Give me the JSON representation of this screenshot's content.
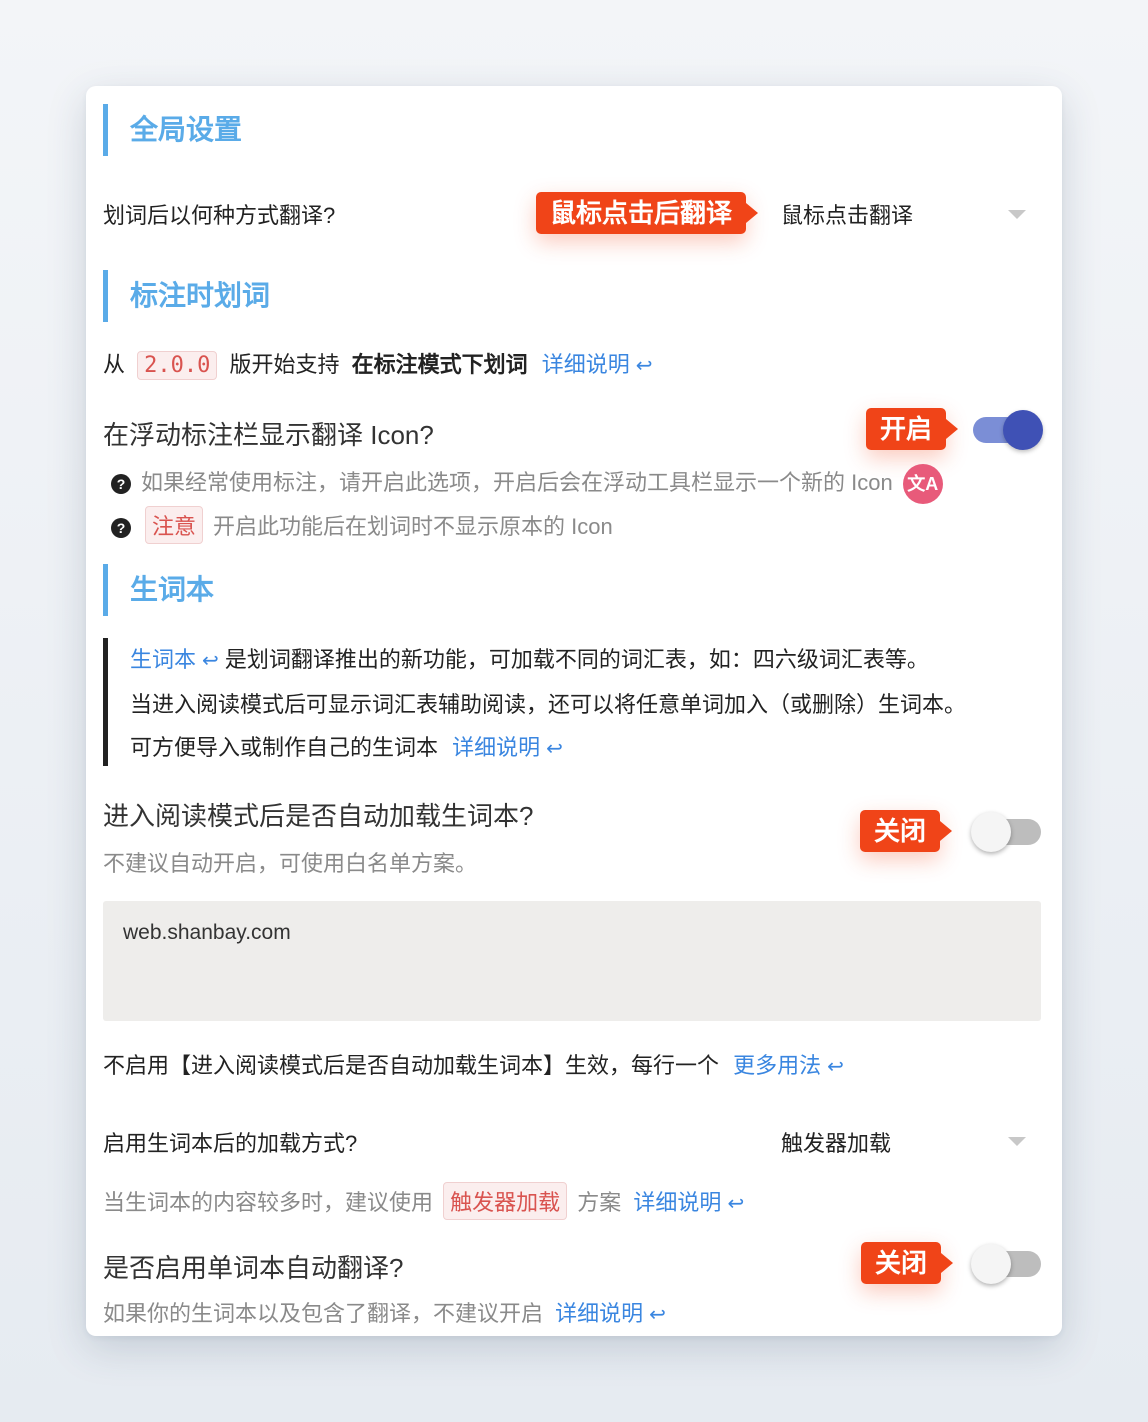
{
  "global": {
    "title": "全局设置",
    "translate_mode_label": "划词后以何种方式翻译?",
    "translate_mode_callout": "鼠标点击后翻译",
    "translate_mode_value": "鼠标点击翻译"
  },
  "annotate": {
    "title": "标注时划词",
    "intro_prefix": "从",
    "intro_version": "2.0.0",
    "intro_mid": "版开始支持",
    "intro_bold": "在标注模式下划词",
    "intro_link": "详细说明",
    "icon_question": "在浮动标注栏显示翻译 Icon?",
    "icon_callout": "开启",
    "icon_switch_state": "on",
    "hint1": "如果经常使用标注，请开启此选项，开启后会在浮动工具栏显示一个新的 Icon",
    "translate_icon_glyph": "文A",
    "hint2_tag": "注意",
    "hint2_text": "开启此功能后在划词时不显示原本的 Icon",
    "question_glyph": "?"
  },
  "vocab": {
    "title": "生词本",
    "quote_link": "生词本",
    "quote_line1": "是划词翻译推出的新功能，可加载不同的词汇表，如：四六级词汇表等。",
    "quote_line2": "当进入阅读模式后可显示词汇表辅助阅读，还可以将任意单词加入（或删除）生词本。",
    "quote_line3": "可方便导入或制作自己的生词本",
    "quote_line3_link": "详细说明",
    "autoload_question": "进入阅读模式后是否自动加载生词本?",
    "autoload_hint": "不建议自动开启，可使用白名单方案。",
    "autoload_callout": "关闭",
    "autoload_switch_state": "off",
    "whitelist_value": "web.shanbay.com",
    "whitelist_note": "不启用【进入阅读模式后是否自动加载生词本】生效，每行一个",
    "whitelist_link": "更多用法",
    "load_mode_label": "启用生词本后的加载方式?",
    "load_mode_value": "触发器加载",
    "load_hint_prefix": "当生词本的内容较多时，建议使用",
    "load_hint_tag": "触发器加载",
    "load_hint_suffix": "方案",
    "load_hint_link": "详细说明",
    "autotrans_question": "是否启用单词本自动翻译?",
    "autotrans_callout": "关闭",
    "autotrans_switch_state": "off",
    "autotrans_hint": "如果你的生词本以及包含了翻译，不建议开启",
    "autotrans_link": "详细说明"
  },
  "return_glyph": "↩",
  "colors": {
    "accent": "#5aabe8",
    "link": "#3a86e0",
    "callout": "#f04418",
    "switch_on": "#3f51b5"
  }
}
